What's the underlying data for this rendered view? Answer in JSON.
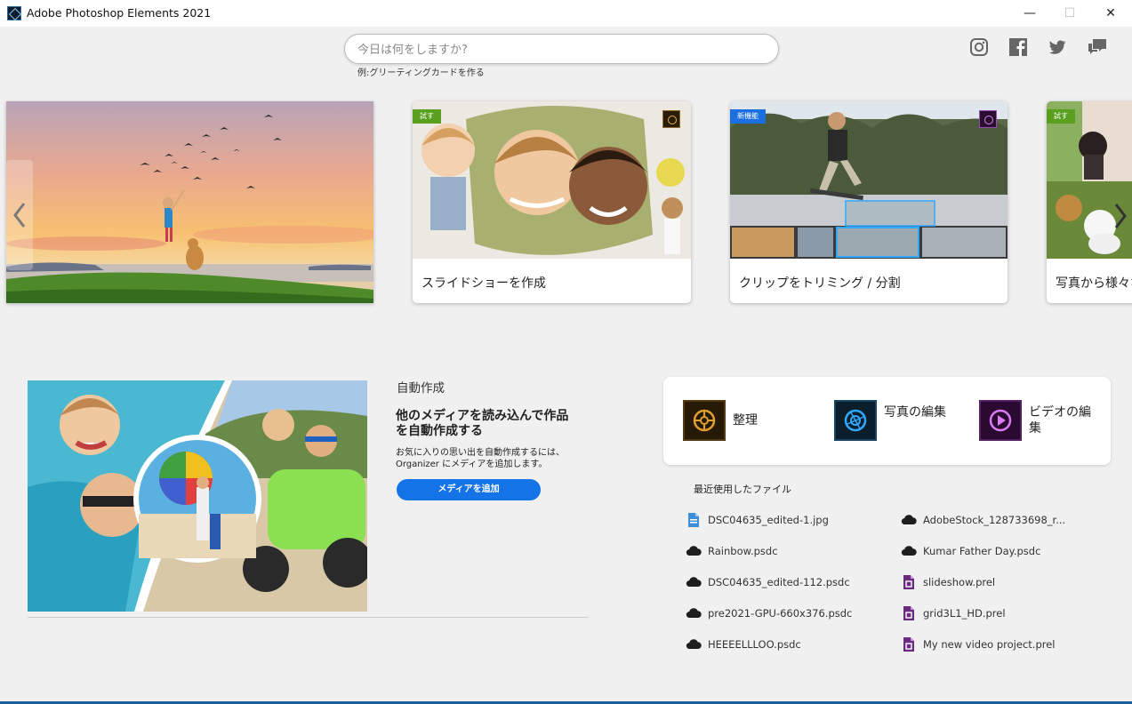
{
  "window": {
    "title": "Adobe Photoshop Elements 2021",
    "controls": {
      "minimize": "—",
      "maximize": "☐",
      "close": "✕"
    }
  },
  "search": {
    "placeholder": "今日は何をしますか?",
    "hint": "例:グリーティングカードを作る"
  },
  "social": [
    "instagram-icon",
    "facebook-icon",
    "twitter-icon",
    "feedback-icon"
  ],
  "carousel": {
    "cards": [
      {
        "title": "スライドショーを作成",
        "badge": "試す"
      },
      {
        "title": "クリップをトリミング / 分割",
        "badge": "新機能"
      },
      {
        "title": "写真から様々な",
        "badge": "試す"
      }
    ]
  },
  "auto_creation": {
    "heading": "自動作成",
    "title": "他のメディアを読み込んで作品を自動作成する",
    "description": "お気に入りの思い出を自動作成するには、Organizer にメディアを追加します。",
    "button": "メディアを追加"
  },
  "launcher": {
    "items": [
      {
        "label": "整理",
        "icon": "organizer-icon",
        "color": "#e0a030"
      },
      {
        "label": "写真の編集",
        "icon": "photo-editor-icon",
        "color": "#31a8ff"
      },
      {
        "label": "ビデオの編集",
        "icon": "video-editor-icon",
        "color": "#d97cf5"
      }
    ]
  },
  "recent": {
    "title": "最近使用したファイル",
    "left": [
      {
        "name": "DSC04635_edited-1.jpg",
        "icon": "image-file-icon"
      },
      {
        "name": "Rainbow.psdc",
        "icon": "cloud-icon"
      },
      {
        "name": "DSC04635_edited-112.psdc",
        "icon": "cloud-icon"
      },
      {
        "name": "pre2021-GPU-660x376.psdc",
        "icon": "cloud-icon"
      },
      {
        "name": "HEEEELLLOO.psdc",
        "icon": "cloud-icon"
      }
    ],
    "right": [
      {
        "name": "AdobeStock_128733698_r...",
        "icon": "cloud-icon"
      },
      {
        "name": "Kumar Father Day.psdc",
        "icon": "cloud-icon"
      },
      {
        "name": "slideshow.prel",
        "icon": "premiere-file-icon"
      },
      {
        "name": "grid3L1_HD.prel",
        "icon": "premiere-file-icon"
      },
      {
        "name": "My new video project.prel",
        "icon": "premiere-file-icon"
      }
    ]
  },
  "colors": {
    "accent": "#1473e6",
    "new_badge": "#1c6fe0",
    "try_badge": "#5aa01e"
  }
}
